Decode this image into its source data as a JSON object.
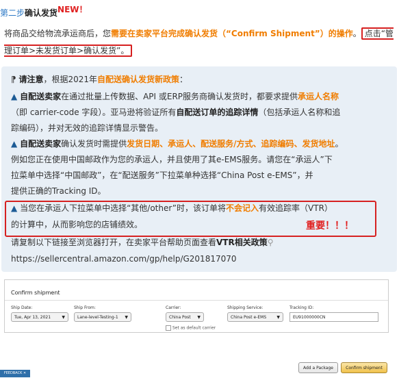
{
  "step": {
    "prefix": "第二步",
    "title": "确认发货",
    "badge": "NEW！"
  },
  "intro": {
    "text1": "将商品交给物流承运商后，您",
    "highlight": "需要在卖家平台完成确认发货（“Confirm Shipment”）的操作",
    "text2": "。",
    "boxed": "点击“管理订单>未发货订单>确认发货”。"
  },
  "notice": {
    "l1_icon": "⁋",
    "l1_bold": "请注意",
    "l1_text": "，根据2021年",
    "l1_orange": "自配送确认发货新政策",
    "l1_end": "：",
    "l2_bold": "自配送卖家",
    "l2_text": "在通过批量上传数据、API 或ERP服务商确认发货时，都要求提供",
    "l2_orange": "承运人名称",
    "l3": "（即 carrier-code 字段）。亚马逊将验证所有",
    "l3_bold": "自配送订单的追踪详情",
    "l3_end": "（包括承运人名称和追",
    "l4": "踪编码），并对无效的追踪详情显示警告。",
    "l5_bold": "自配送卖家",
    "l5_text": "确认发货时需提供",
    "l5_orange": "发货日期、承运人、配送服务/方式、追踪编码、发货地址",
    "l5_end": "。",
    "l6": "例如您正在使用中国邮政作为您的承运人，并且使用了其e-EMS服务。请您在“承运人”下",
    "l7": "拉菜单中选择“中国邮政”，在“配送服务”下拉菜单种选择“China Post e-EMS”，并",
    "l8": "提供正确的Tracking ID。",
    "l9_text": "当您在承运人下拉菜单中选择“其他/other”时，该订单将",
    "l9_orange": "不会记入",
    "l9_end": "有效追踪率（VTR）",
    "l10": "的计算中，从而影响您的店铺绩效。",
    "important": "重要！！！",
    "l11_text": "请复制以下链接至浏览器打开，在卖家平台帮助页面查看",
    "l11_bold": "VTR相关政策",
    "url": "https://sellercentral.amazon.com/gp/help/G201817070"
  },
  "form": {
    "title": "Confirm shipment",
    "ship_date_label": "Ship Date:",
    "ship_date_value": "Tue, Apr 13, 2021",
    "ship_from_label": "Ship From:",
    "ship_from_value": "Lane-level-Testing-1",
    "carrier_label": "Carrier:",
    "carrier_value": "China Post",
    "default_carrier_label": "Set as default carrier",
    "service_label": "Shipping Service:",
    "service_value": "China Post e-EMS",
    "tracking_label": "Tracking ID:",
    "tracking_value": "EU91000000CN"
  },
  "buttons": {
    "add_package": "Add a Package",
    "confirm": "Confirm shipment"
  },
  "feedback": "FEEDBACK ✕",
  "colors": {
    "orange": "#f07d00",
    "red": "#d62020",
    "notice_bg": "#e8eff6",
    "link_blue": "#2b78c5"
  }
}
